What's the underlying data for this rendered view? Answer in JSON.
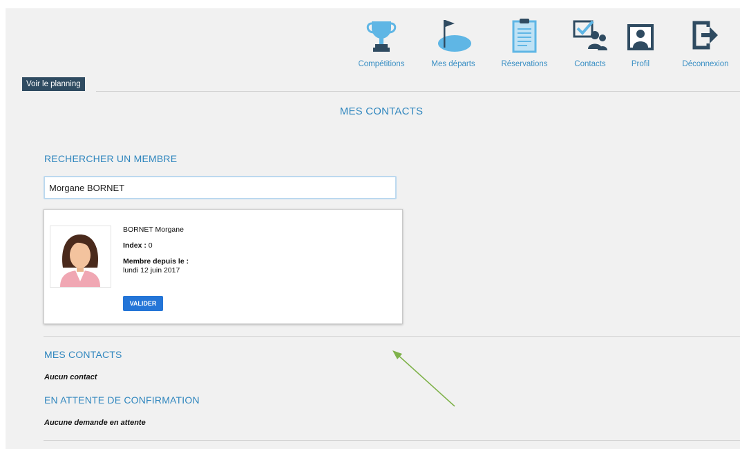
{
  "nav": {
    "items": [
      {
        "id": "competitions",
        "label": "Compétitions",
        "icon": "trophy-icon"
      },
      {
        "id": "mes-departs",
        "label": "Mes départs",
        "icon": "golf-flag-icon"
      },
      {
        "id": "reservations",
        "label": "Réservations",
        "icon": "clipboard-icon"
      },
      {
        "id": "contacts",
        "label": "Contacts",
        "icon": "contacts-icon"
      },
      {
        "id": "profil",
        "label": "Profil",
        "icon": "profile-icon"
      },
      {
        "id": "deconnexion",
        "label": "Déconnexion",
        "icon": "logout-icon"
      }
    ]
  },
  "planning_button": "Voir le planning",
  "page_title": "MES CONTACTS",
  "search": {
    "title": "RECHERCHER UN MEMBRE",
    "value": "Morgane BORNET"
  },
  "result": {
    "name": "BORNET Morgane",
    "index_label": "Index :",
    "index_value": "0",
    "member_since_label": "Membre depuis le :",
    "member_since_value": "lundi 12 juin 2017",
    "validate_label": "VALIDER"
  },
  "contacts": {
    "title": "MES CONTACTS",
    "empty_text": "Aucun contact"
  },
  "pending": {
    "title": "EN ATTENTE DE CONFIRMATION",
    "empty_text": "Aucune demande en attente"
  },
  "colors": {
    "accent": "#3a8fc4",
    "icon_light": "#5fb6e5",
    "icon_dark": "#2f4b61",
    "button": "#2475d7",
    "annotation_arrow": "#7fb24a"
  }
}
